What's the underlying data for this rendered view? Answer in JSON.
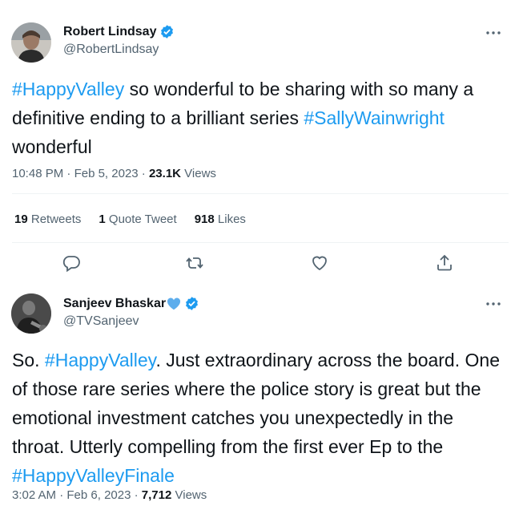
{
  "tweets": [
    {
      "display_name": "Robert Lindsay",
      "handle": "@RobertLindsay",
      "verified": true,
      "body": [
        {
          "text": "#HappyValley",
          "hashtag": true
        },
        {
          "text": " so wonderful to be sharing with so many a definitive ending to a brilliant series ",
          "hashtag": false
        },
        {
          "text": "#SallyWainwright",
          "hashtag": true
        },
        {
          "text": " wonderful",
          "hashtag": false
        }
      ],
      "time": "10:48 PM",
      "date": "Feb 5, 2023",
      "views_count": "23.1K",
      "views_label": "Views",
      "stats": {
        "retweets_count": "19",
        "retweets_label": "Retweets",
        "quotes_count": "1",
        "quotes_label": "Quote Tweet",
        "likes_count": "918",
        "likes_label": "Likes"
      }
    },
    {
      "display_name": "Sanjeev Bhaskar",
      "handle": "@TVSanjeev",
      "verified": true,
      "body": [
        {
          "text": "So. ",
          "hashtag": false
        },
        {
          "text": "#HappyValley",
          "hashtag": true
        },
        {
          "text": ". Just extraordinary across the board. One of those rare series where the police story is great but the emotional investment catches you unexpectedly in the throat. Utterly compelling from the first ever Ep to the ",
          "hashtag": false
        },
        {
          "text": "#HappyValleyFinale",
          "hashtag": true
        }
      ],
      "time": "3:02 AM",
      "date": "Feb 6, 2023",
      "views_count": "7,712",
      "views_label": "Views"
    }
  ],
  "icons": {
    "more": "more-dots-icon",
    "verified": "verified-badge-icon",
    "reply": "reply-icon",
    "retweet": "retweet-icon",
    "like": "like-icon",
    "share": "share-icon",
    "heart_emoji": "blue-heart-emoji"
  },
  "colors": {
    "accent": "#1d9bf0",
    "text": "#0f1419",
    "muted": "#536471",
    "divider": "#eff3f4"
  }
}
